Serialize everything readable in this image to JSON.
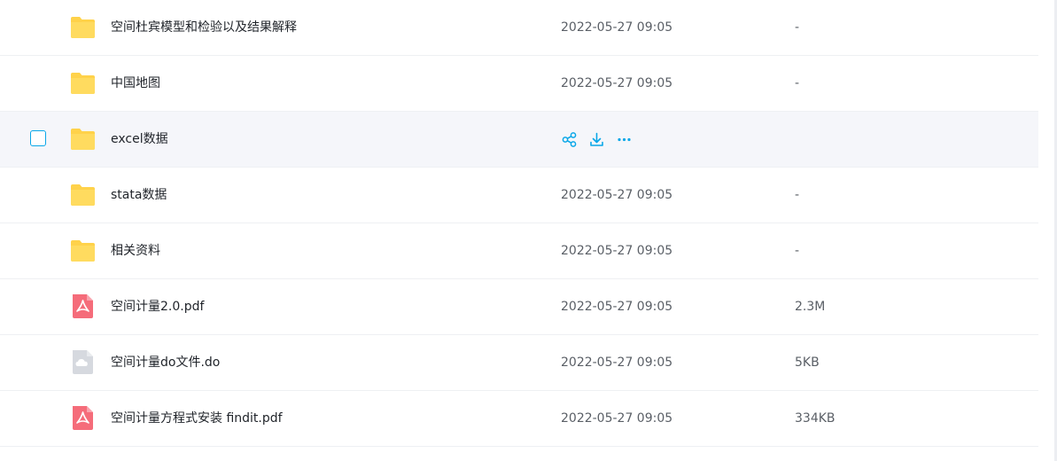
{
  "files": [
    {
      "name": "空间杜宾模型和检验以及结果解释",
      "type": "folder",
      "date": "2022-05-27 09:05",
      "size": "-"
    },
    {
      "name": "中国地图",
      "type": "folder",
      "date": "2022-05-27 09:05",
      "size": "-"
    },
    {
      "name": "excel数据",
      "type": "folder",
      "date": "",
      "size": "",
      "hovered": true
    },
    {
      "name": "stata数据",
      "type": "folder",
      "date": "2022-05-27 09:05",
      "size": "-"
    },
    {
      "name": "相关资料",
      "type": "folder",
      "date": "2022-05-27 09:05",
      "size": "-"
    },
    {
      "name": "空间计量2.0.pdf",
      "type": "pdf",
      "date": "2022-05-27 09:05",
      "size": "2.3M"
    },
    {
      "name": "空间计量do文件.do",
      "type": "generic",
      "date": "2022-05-27 09:05",
      "size": "5KB"
    },
    {
      "name": "空间计量方程式安装 findit.pdf",
      "type": "pdf",
      "date": "2022-05-27 09:05",
      "size": "334KB"
    }
  ],
  "icons": {
    "folder": "folder-icon",
    "pdf": "pdf-file-icon",
    "generic": "cloud-file-icon",
    "share": "share-icon",
    "download": "download-icon",
    "more": "more-icon"
  },
  "colors": {
    "folder": "#ffd24a",
    "pdf": "#f56c7a",
    "generic": "#d6d9df",
    "accent": "#09a7e8",
    "hover_bg": "#f5f6fa"
  }
}
